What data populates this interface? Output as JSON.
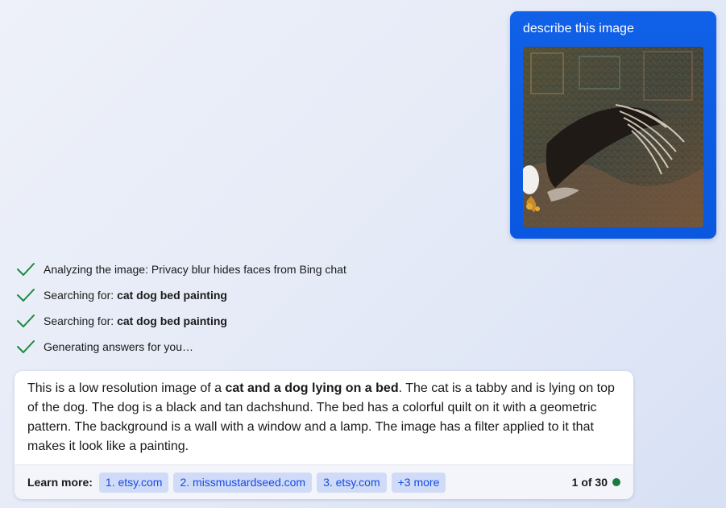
{
  "user_message": {
    "text": "describe this image",
    "image_icon": "eagle-painting-image",
    "bubble_color": "#0b5be3"
  },
  "steps": [
    {
      "icon": "check-icon",
      "text": "Analyzing the image: Privacy blur hides faces from Bing chat",
      "query": ""
    },
    {
      "icon": "check-icon",
      "text": "Searching for: ",
      "query": "cat dog bed painting"
    },
    {
      "icon": "check-icon",
      "text": "Searching for: ",
      "query": "cat dog bed painting"
    },
    {
      "icon": "check-icon",
      "text": "Generating answers for you…",
      "query": ""
    }
  ],
  "answer": {
    "intro": "This is a low resolution image of a ",
    "bold": "cat and a dog lying on a bed",
    "rest": ". The cat is a tabby and is lying on top of the dog. The dog is a black and tan dachshund. The bed has a colorful quilt on it with a geometric pattern. The background is a wall with a window and a lamp. The image has a filter applied to it that makes it look like a painting."
  },
  "learn_more": {
    "label": "Learn more:",
    "citations": [
      "1. etsy.com",
      "2. missmustardseed.com",
      "3. etsy.com",
      "+3 more"
    ],
    "counter": "1 of 30",
    "status_color": "#1e7a3c"
  },
  "colors": {
    "check": "#1a8a3c",
    "citation_bg": "#cfdbf7",
    "citation_text": "#174ae4"
  }
}
